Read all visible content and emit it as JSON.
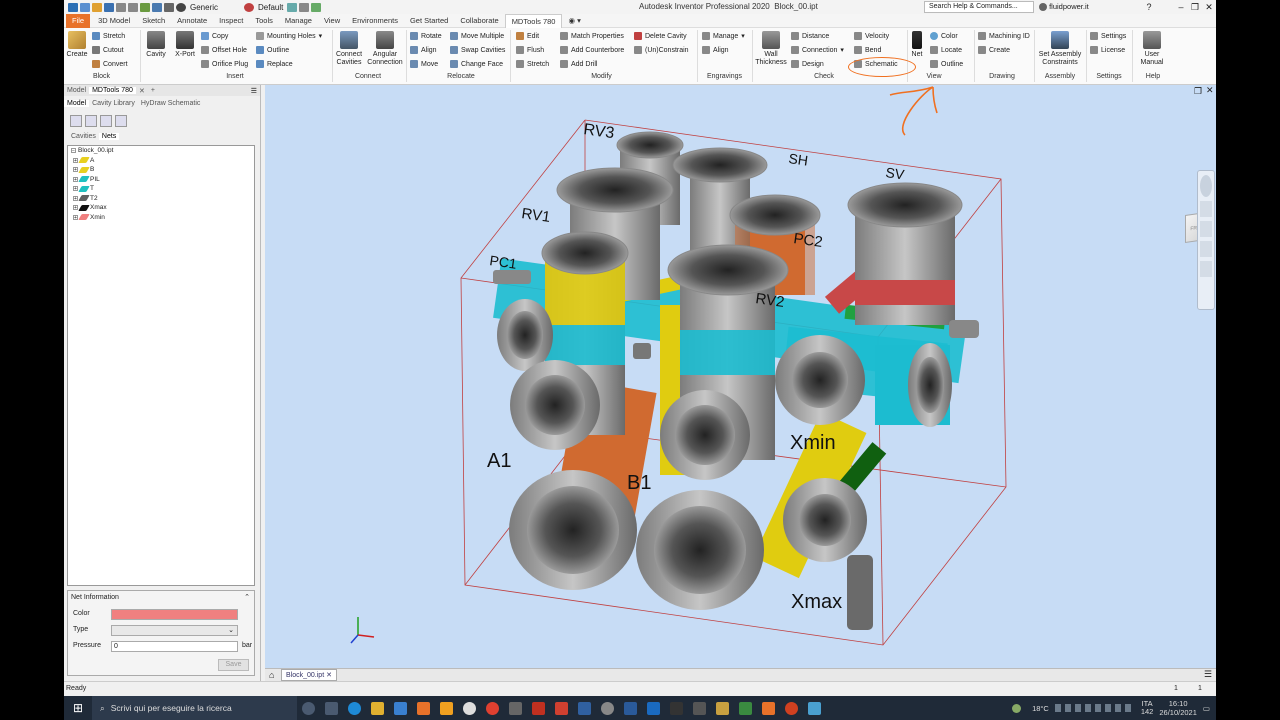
{
  "title": {
    "app": "Autodesk Inventor Professional 2020",
    "file": "Block_00.ipt",
    "style": "Generic",
    "appearance": "Default",
    "search": "Search Help & Commands...",
    "user": "fluidpower.it"
  },
  "tabs": [
    "File",
    "3D Model",
    "Sketch",
    "Annotate",
    "Inspect",
    "Tools",
    "Manage",
    "View",
    "Environments",
    "Get Started",
    "Collaborate",
    "MDTools 780"
  ],
  "ribbon": {
    "block": {
      "group": "Block",
      "create": "Create",
      "stretch": "Stretch",
      "cutout": "Cutout",
      "convert": "Convert"
    },
    "insert": {
      "group": "Insert",
      "cavity": "Cavity",
      "xport": "X-Port",
      "copy": "Copy",
      "offset": "Offset Hole",
      "orifice": "Orifice Plug",
      "mounting": "Mounting Holes",
      "outline": "Outline",
      "replace": "Replace"
    },
    "connect": {
      "group": "Connect",
      "cc1": "Connect",
      "cc2": "Cavities",
      "ac1": "Angular",
      "ac2": "Connection"
    },
    "relocate": {
      "group": "Relocate",
      "rotate": "Rotate",
      "align": "Align",
      "move": "Move",
      "movemult": "Move Multiple",
      "swap": "Swap Cavities",
      "changeface": "Change Face"
    },
    "modify": {
      "group": "Modify",
      "edit": "Edit",
      "flush": "Flush",
      "stretch": "Stretch",
      "match": "Match Properties",
      "counterbore": "Add Counterbore",
      "drill": "Add Drill",
      "delete": "Delete Cavity",
      "unconstrain": "(Un)Constrain"
    },
    "engravings": {
      "group": "Engravings",
      "manage": "Manage",
      "align": "Align"
    },
    "check": {
      "group": "Check",
      "wall1": "Wall",
      "wall2": "Thickness",
      "distance": "Distance",
      "connection": "Connection",
      "design": "Design",
      "velocity": "Velocity",
      "bend": "Bend",
      "schematic": "Schematic"
    },
    "view": {
      "group": "View",
      "net": "Net",
      "color": "Color",
      "locate": "Locate",
      "outline": "Outline"
    },
    "drawing": {
      "group": "Drawing",
      "machining": "Machining ID",
      "create": "Create"
    },
    "assembly": {
      "group": "Assembly",
      "sa1": "Set Assembly",
      "sa2": "Constraints"
    },
    "settings": {
      "group": "Settings",
      "settings": "Settings",
      "license": "License"
    },
    "help": {
      "group": "Help",
      "um1": "User",
      "um2": "Manual"
    }
  },
  "panel": {
    "tabs": [
      "Model",
      "MDTools 780"
    ],
    "subtabs": [
      "Model",
      "Cavity Library",
      "HyDraw Schematic"
    ],
    "nettabs": [
      "Cavities",
      "Nets"
    ],
    "tree": [
      {
        "label": "Block_00.ipt",
        "color": ""
      },
      {
        "label": "A",
        "color": "#e8d020"
      },
      {
        "label": "B",
        "color": "#e8d020"
      },
      {
        "label": "PIL",
        "color": "#20c0c0"
      },
      {
        "label": "T",
        "color": "#20c0c0"
      },
      {
        "label": "T2",
        "color": "#606060"
      },
      {
        "label": "Xmax",
        "color": "#101010"
      },
      {
        "label": "Xmin",
        "color": "#f08080"
      }
    ],
    "netinfo": {
      "title": "Net Information",
      "color_label": "Color",
      "color_value": "#f08080",
      "type_label": "Type",
      "pressure_label": "Pressure",
      "pressure_value": "0",
      "unit": "bar",
      "save": "Save"
    }
  },
  "viewport": {
    "labels": [
      "RV3",
      "SH",
      "SV",
      "RV1",
      "PC2",
      "PC1",
      "RV2",
      "A1",
      "B1",
      "Xmin",
      "Xmax"
    ],
    "viewcube": "FRONT"
  },
  "doc_tab": "Block_00.ipt",
  "status": {
    "text": "Ready",
    "n1": "1",
    "n2": "1"
  },
  "taskbar": {
    "search": "Scrivi qui per eseguire la ricerca",
    "temp": "18°C",
    "lang1": "ITA",
    "lang2": "142",
    "time": "16:10",
    "date": "26/10/2021"
  }
}
